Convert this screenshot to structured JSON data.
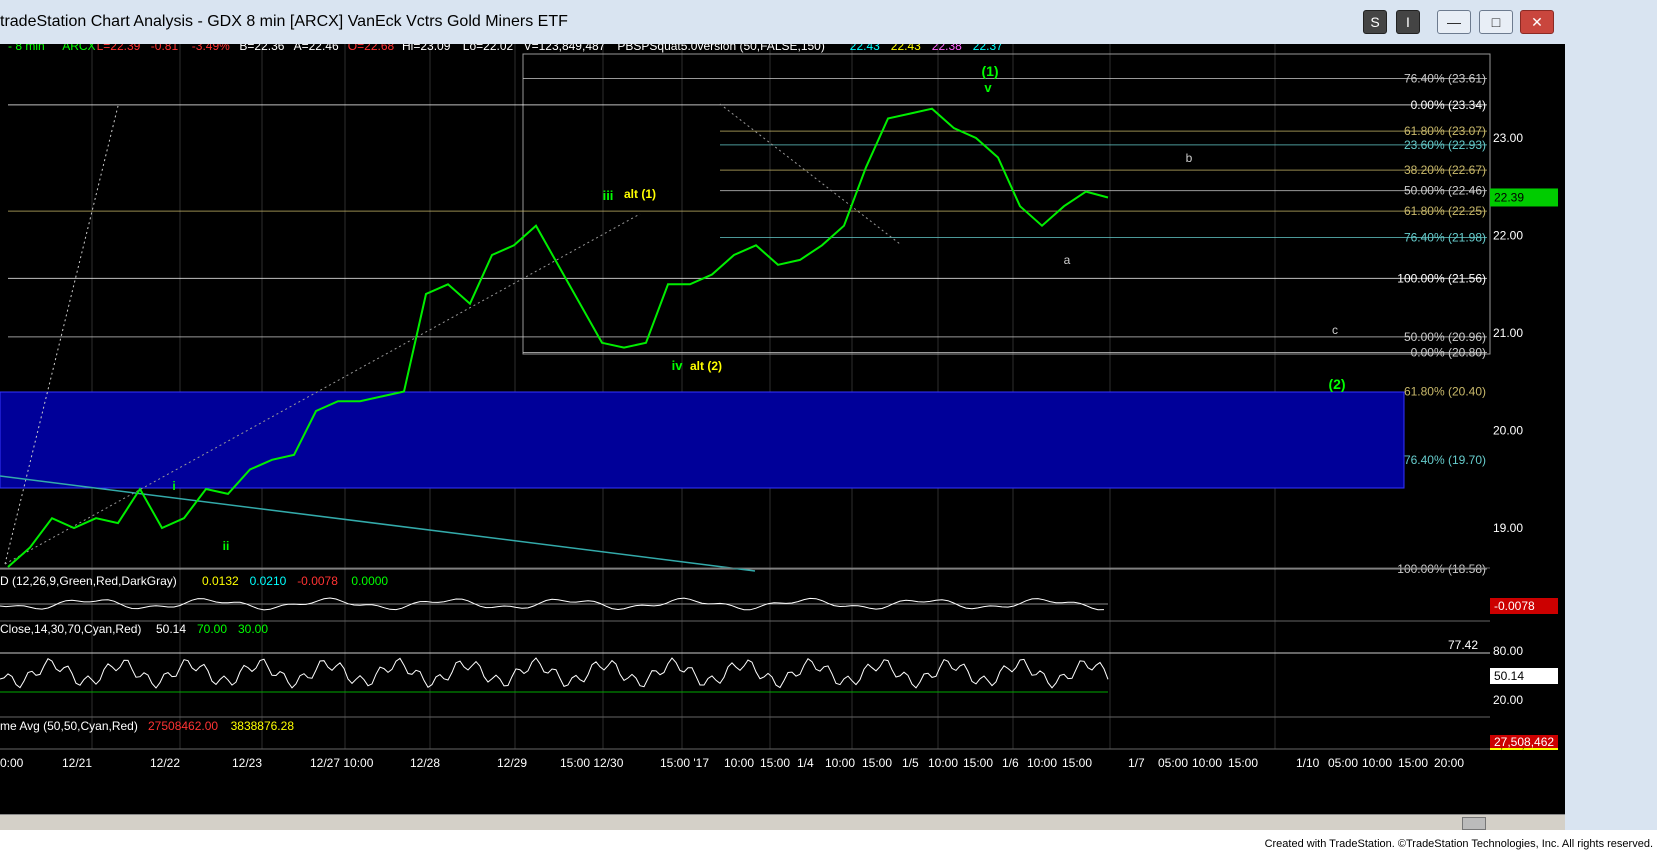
{
  "window": {
    "title": "tradeStation Chart Analysis - GDX 8 min [ARCX] VanEck Vctrs Gold Miners ETF",
    "buttons": [
      "S",
      "I",
      "—",
      "□",
      "✕"
    ]
  },
  "header": {
    "items": [
      {
        "text": "- 8 min",
        "color": "#00ff00"
      },
      {
        "text": "ARCX",
        "color": "#00ff00"
      },
      {
        "text": "L=22.39",
        "color": "#ff3333"
      },
      {
        "text": "-0.81",
        "color": "#ff3333"
      },
      {
        "text": "-3.49%",
        "color": "#ff3333"
      },
      {
        "text": "B=22.36",
        "color": "#ffffff"
      },
      {
        "text": "A=22.46",
        "color": "#ffffff"
      },
      {
        "text": "O=22.68",
        "color": "#ff3333"
      },
      {
        "text": "Hi=23.09",
        "color": "#ffffff"
      },
      {
        "text": "Lo=22.02",
        "color": "#ffffff"
      },
      {
        "text": "V=123,849,487",
        "color": "#ffffff"
      },
      {
        "text": "PBSPSquat5.0version (50,FALSE,150)",
        "color": "#ffffff"
      },
      {
        "text": "22.43",
        "color": "#00ffff"
      },
      {
        "text": "22.43",
        "color": "#ffff00"
      },
      {
        "text": "22.38",
        "color": "#ff66ff"
      },
      {
        "text": "22.37",
        "color": "#00ffff"
      }
    ]
  },
  "price_axis": {
    "ticks": [
      "23.00",
      "22.00",
      "21.00",
      "20.00",
      "19.00"
    ],
    "last_price": "22.39"
  },
  "fib_labels": [
    {
      "text": "76.40% (23.61)",
      "price": 23.61,
      "color": "#cccccc"
    },
    {
      "text": "0.00% (23.34)",
      "price": 23.34,
      "color": "#ffffff"
    },
    {
      "text": "61.80% (23.07)",
      "price": 23.07,
      "color": "#c8b86a"
    },
    {
      "text": "23.60% (22.93)",
      "price": 22.93,
      "color": "#66cccc"
    },
    {
      "text": "38.20% (22.67)",
      "price": 22.67,
      "color": "#c8b86a"
    },
    {
      "text": "50.00% (22.46)",
      "price": 22.46,
      "color": "#cccccc"
    },
    {
      "text": "61.80% (22.25)",
      "price": 22.25,
      "color": "#c8b86a"
    },
    {
      "text": "76.40% (21.98)",
      "price": 21.98,
      "color": "#66cccc"
    },
    {
      "text": "100.00% (21.56)",
      "price": 21.56,
      "color": "#ffffff"
    },
    {
      "text": "50.00% (20.96)",
      "price": 20.96,
      "color": "#cccccc"
    },
    {
      "text": "0.00% (20.80)",
      "price": 20.8,
      "color": "#cccccc"
    },
    {
      "text": "61.80% (20.40)",
      "price": 20.4,
      "color": "#c8b86a"
    },
    {
      "text": "76.40% (19.70)",
      "price": 19.7,
      "color": "#66cccc"
    },
    {
      "text": "100.00% (18.58)",
      "price": 18.58,
      "color": "#cccccc"
    }
  ],
  "wave_labels": [
    {
      "text": "(1)",
      "color": "#00ff00"
    },
    {
      "text": "v",
      "color": "#00ff00"
    },
    {
      "text": "iii",
      "color": "#00ff00"
    },
    {
      "text": "alt (1)",
      "color": "#ffff00"
    },
    {
      "text": "iv",
      "color": "#00ff00"
    },
    {
      "text": "alt (2)",
      "color": "#ffff00"
    },
    {
      "text": "i",
      "color": "#00ff00"
    },
    {
      "text": "ii",
      "color": "#00ff00"
    },
    {
      "text": "a",
      "color": "#cccccc"
    },
    {
      "text": "b",
      "color": "#cccccc"
    },
    {
      "text": "c",
      "color": "#cccccc"
    },
    {
      "text": "(2)",
      "color": "#00ff00"
    }
  ],
  "macd": {
    "title": "D (12,26,9,Green,Red,DarkGray)",
    "values": [
      {
        "text": "0.0132",
        "color": "#ffff00"
      },
      {
        "text": "0.0210",
        "color": "#00ffff"
      },
      {
        "text": "-0.0078",
        "color": "#ff3333"
      },
      {
        "text": "0.0000",
        "color": "#00ff00"
      }
    ],
    "last": "-0.0078"
  },
  "rsi": {
    "title": "Close,14,30,70,Cyan,Red)",
    "values": [
      {
        "text": "50.14",
        "color": "#ffffff"
      },
      {
        "text": "70.00",
        "color": "#00ff00"
      },
      {
        "text": "30.00",
        "color": "#00ff00"
      }
    ],
    "ticks": [
      "77.42",
      "80.00",
      "50.14",
      "20.00"
    ]
  },
  "volume": {
    "title": "me Avg (50,50,Cyan,Red)",
    "values": [
      {
        "text": "27508462.00",
        "color": "#ff3333"
      },
      {
        "text": "3838876.28",
        "color": "#ffff00"
      }
    ],
    "last": "27,508,462",
    "last2": "3,838,876"
  },
  "time_axis": [
    "0:00",
    "12/21",
    "12/22",
    "12/23",
    "12/27 10:00",
    "12/28",
    "12/29",
    "15:00 12/30",
    "15:00 '17",
    "10:00",
    "15:00",
    "1/4",
    "10:00",
    "15:00",
    "1/5",
    "10:00",
    "15:00",
    "1/6",
    "10:00",
    "15:00",
    "1/7",
    "05:00",
    "10:00",
    "15:00",
    "1/10",
    "05:00",
    "10:00",
    "15:00",
    "20:00"
  ],
  "footer": "Created with TradeStation. ©TradeStation Technologies, Inc. All rights reserved.",
  "chart_data": {
    "type": "line",
    "symbol": "GDX 8 min",
    "x_ticks": [
      "12/21",
      "12/22",
      "12/23",
      "12/27",
      "12/28",
      "12/29",
      "12/30",
      "'17",
      "1/4",
      "1/5",
      "1/6"
    ],
    "price_path": [
      18.6,
      18.8,
      19.1,
      19.0,
      19.1,
      19.05,
      19.4,
      19.0,
      19.1,
      19.4,
      19.35,
      19.6,
      19.7,
      19.75,
      20.2,
      20.3,
      20.3,
      20.35,
      20.4,
      21.4,
      21.5,
      21.3,
      21.8,
      21.9,
      22.1,
      21.7,
      21.3,
      20.9,
      20.85,
      20.9,
      21.5,
      21.5,
      21.6,
      21.8,
      21.9,
      21.7,
      21.75,
      21.9,
      22.1,
      22.7,
      23.2,
      23.25,
      23.3,
      23.1,
      23.0,
      22.8,
      22.3,
      22.1,
      22.3,
      22.45,
      22.39
    ],
    "ylim": [
      18.4,
      23.9
    ]
  }
}
